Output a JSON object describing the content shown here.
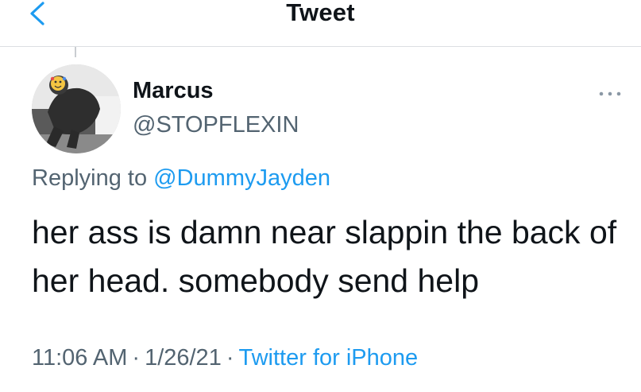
{
  "header": {
    "title": "Tweet",
    "back_icon": "chevron-left-icon"
  },
  "tweet": {
    "author": {
      "display_name": "Marcus",
      "handle": "@STOPFLEXIN"
    },
    "more_icon": "more-horizontal-icon",
    "reply_prefix": "Replying to",
    "reply_to": "@DummyJayden",
    "text": "her ass is damn near slappin the back of her head. somebody send help",
    "time": "11:06 AM",
    "date": "1/26/21",
    "separator": "·",
    "source": "Twitter for iPhone"
  },
  "colors": {
    "accent": "#1d9bf0",
    "text_primary": "#0f1419",
    "text_secondary": "#536471",
    "divider": "#dcdfe2"
  }
}
